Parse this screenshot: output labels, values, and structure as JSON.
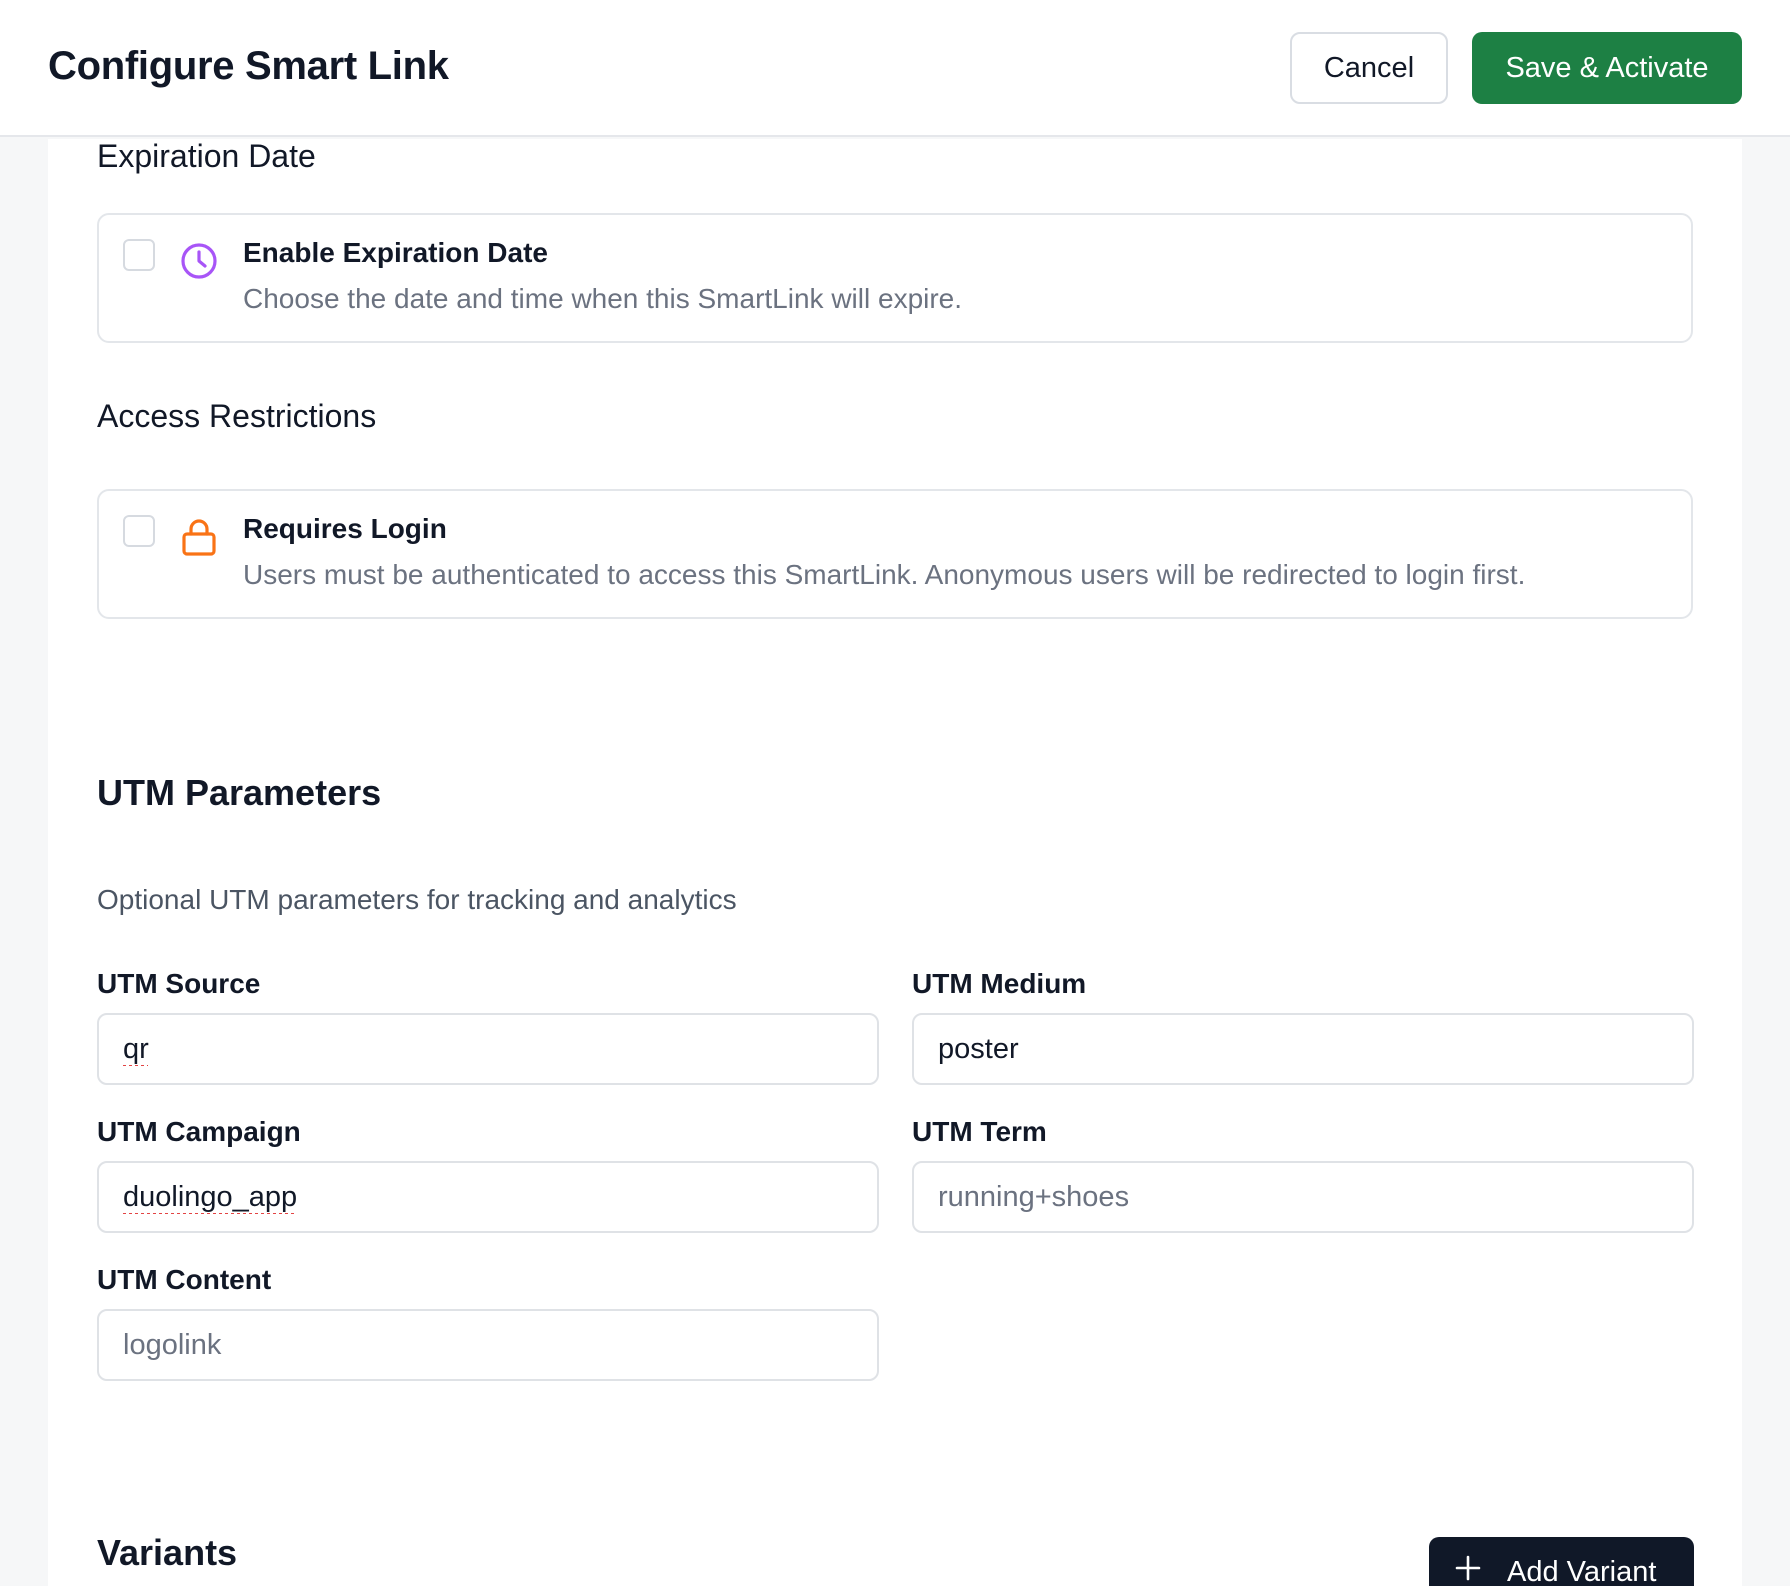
{
  "header": {
    "title": "Configure Smart Link",
    "cancel_label": "Cancel",
    "save_label": "Save & Activate"
  },
  "colors": {
    "accent_green": "#1d8044",
    "clock_icon": "#a855f7",
    "lock_icon": "#f97316",
    "dark_button": "#101828"
  },
  "expiration": {
    "section_label": "Expiration Date",
    "option_title": "Enable Expiration Date",
    "option_desc": "Choose the date and time when this SmartLink will expire.",
    "checked": false,
    "icon": "clock-icon"
  },
  "access": {
    "section_label": "Access Restrictions",
    "option_title": "Requires Login",
    "option_desc": "Users must be authenticated to access this SmartLink. Anonymous users will be redirected to login first.",
    "checked": false,
    "icon": "lock-icon"
  },
  "utm": {
    "heading": "UTM Parameters",
    "description": "Optional UTM parameters for tracking and analytics",
    "source": {
      "label": "UTM Source",
      "value": "qr",
      "placeholder": ""
    },
    "medium": {
      "label": "UTM Medium",
      "value": "poster",
      "placeholder": ""
    },
    "campaign": {
      "label": "UTM Campaign",
      "value": "duolingo_app",
      "placeholder": ""
    },
    "term": {
      "label": "UTM Term",
      "value": "",
      "placeholder": "running+shoes"
    },
    "content": {
      "label": "UTM Content",
      "value": "",
      "placeholder": "logolink"
    }
  },
  "variants": {
    "heading": "Variants",
    "add_label": "Add Variant",
    "add_icon": "plus-icon"
  }
}
